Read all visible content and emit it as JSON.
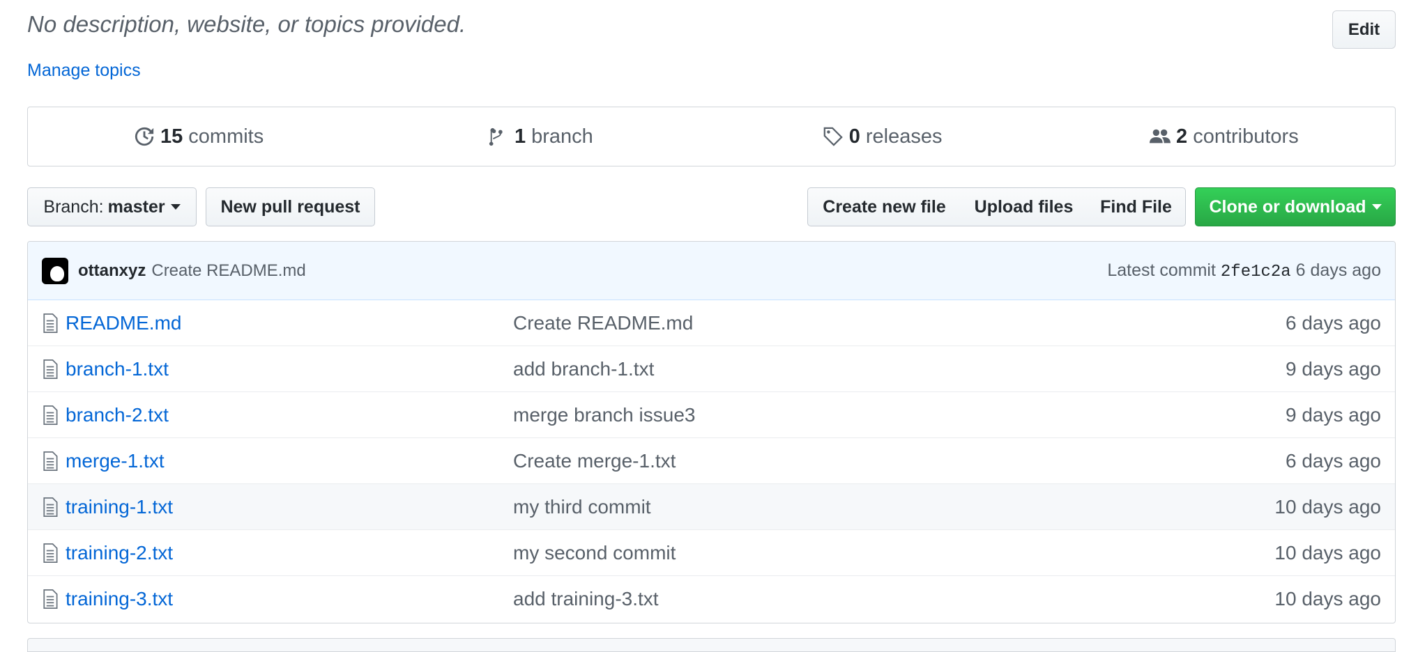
{
  "repo": {
    "description": "No description, website, or topics provided.",
    "manage_topics": "Manage topics",
    "edit_label": "Edit"
  },
  "summary": {
    "commits": {
      "count": "15",
      "label": "commits",
      "icon": "history-icon"
    },
    "branches": {
      "count": "1",
      "label": "branch",
      "icon": "git-branch-icon"
    },
    "releases": {
      "count": "0",
      "label": "releases",
      "icon": "tag-icon"
    },
    "contributors": {
      "count": "2",
      "label": "contributors",
      "icon": "people-icon"
    }
  },
  "toolbar": {
    "branch_prefix": "Branch:",
    "branch_name": "master",
    "new_pull_request": "New pull request",
    "create_new_file": "Create new file",
    "upload_files": "Upload files",
    "find_file": "Find File",
    "clone_or_download": "Clone or download"
  },
  "latest_commit": {
    "author": "ottanxyz",
    "message": "Create README.md",
    "prefix": "Latest commit",
    "sha": "2fe1c2a",
    "age": "6 days ago"
  },
  "files": [
    {
      "name": "README.md",
      "message": "Create README.md",
      "age": "6 days ago"
    },
    {
      "name": "branch-1.txt",
      "message": "add branch-1.txt",
      "age": "9 days ago"
    },
    {
      "name": "branch-2.txt",
      "message": "merge branch issue3",
      "age": "9 days ago"
    },
    {
      "name": "merge-1.txt",
      "message": "Create merge-1.txt",
      "age": "6 days ago"
    },
    {
      "name": "training-1.txt",
      "message": "my third commit",
      "age": "10 days ago"
    },
    {
      "name": "training-2.txt",
      "message": "my second commit",
      "age": "10 days ago"
    },
    {
      "name": "training-3.txt",
      "message": "add training-3.txt",
      "age": "10 days ago"
    }
  ],
  "colors": {
    "link": "#0366d6",
    "clone_button": "#28a745",
    "commit_tease_bg": "#f1f8ff"
  }
}
